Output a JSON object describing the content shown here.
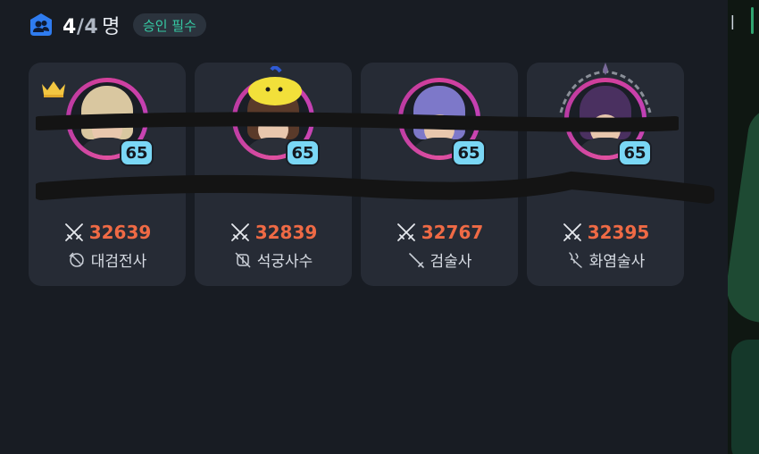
{
  "party": {
    "current": "4",
    "separator": "/",
    "max": "4",
    "unit": "명",
    "badge": "승인 필수",
    "icon": "party-members-icon"
  },
  "side_mark": "ㅣ",
  "members": [
    {
      "level": "65",
      "power": "32639",
      "class": "대검전사",
      "class_icon": "greatsword-icon",
      "leader": true,
      "hair": "#d9c7a0"
    },
    {
      "level": "65",
      "power": "32839",
      "class": "석궁사수",
      "class_icon": "crossbow-icon",
      "leader": false,
      "hair": "#5a3a2a"
    },
    {
      "level": "65",
      "power": "32767",
      "class": "검술사",
      "class_icon": "sword-icon",
      "leader": false,
      "hair": "#7d78c9"
    },
    {
      "level": "65",
      "power": "32395",
      "class": "화염술사",
      "class_icon": "flame-staff-icon",
      "leader": false,
      "hair": "#4a3060"
    }
  ],
  "colors": {
    "power": "#ef6a45",
    "level_badge": "#7ad7f5",
    "badge_text": "#36c8a3",
    "ring": "#d4409a"
  }
}
